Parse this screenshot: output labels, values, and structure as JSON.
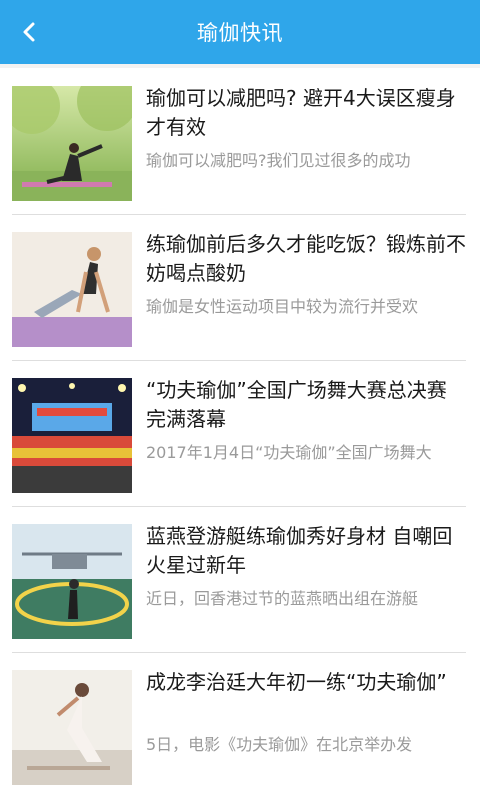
{
  "header": {
    "title": "瑜伽快讯",
    "back_icon": "chevron-left-icon",
    "background": "#2fa6ea"
  },
  "news": [
    {
      "title": "瑜伽可以减肥吗? 避开4大误区瘦身才有效",
      "summary": "瑜伽可以减肥吗?我们见过很多的成功",
      "image": "woman-yoga-pose-park-photo"
    },
    {
      "title": "练瑜伽前后多久才能吃饭？锻炼前不妨喝点酸奶",
      "summary": "瑜伽是女性运动项目中较为流行并受欢",
      "image": "woman-cobra-pose-mat-photo"
    },
    {
      "title": "“功夫瑜伽”全国广场舞大赛总决赛完满落幕",
      "summary": "2017年1月4日“功夫瑜伽”全国广场舞大",
      "image": "stage-dance-competition-photo"
    },
    {
      "title": "蓝燕登游艇练瑜伽秀好身材 自嘲回火星过新年",
      "summary": "近日，回香港过节的蓝燕晒出组在游艇",
      "image": "woman-yoga-helipad-yacht-photo"
    },
    {
      "title": "成龙李治廷大年初一练“功夫瑜伽”",
      "summary": "5日，电影《功夫瑜伽》在北京举办发",
      "image": "woman-backbend-beach-photo"
    }
  ]
}
